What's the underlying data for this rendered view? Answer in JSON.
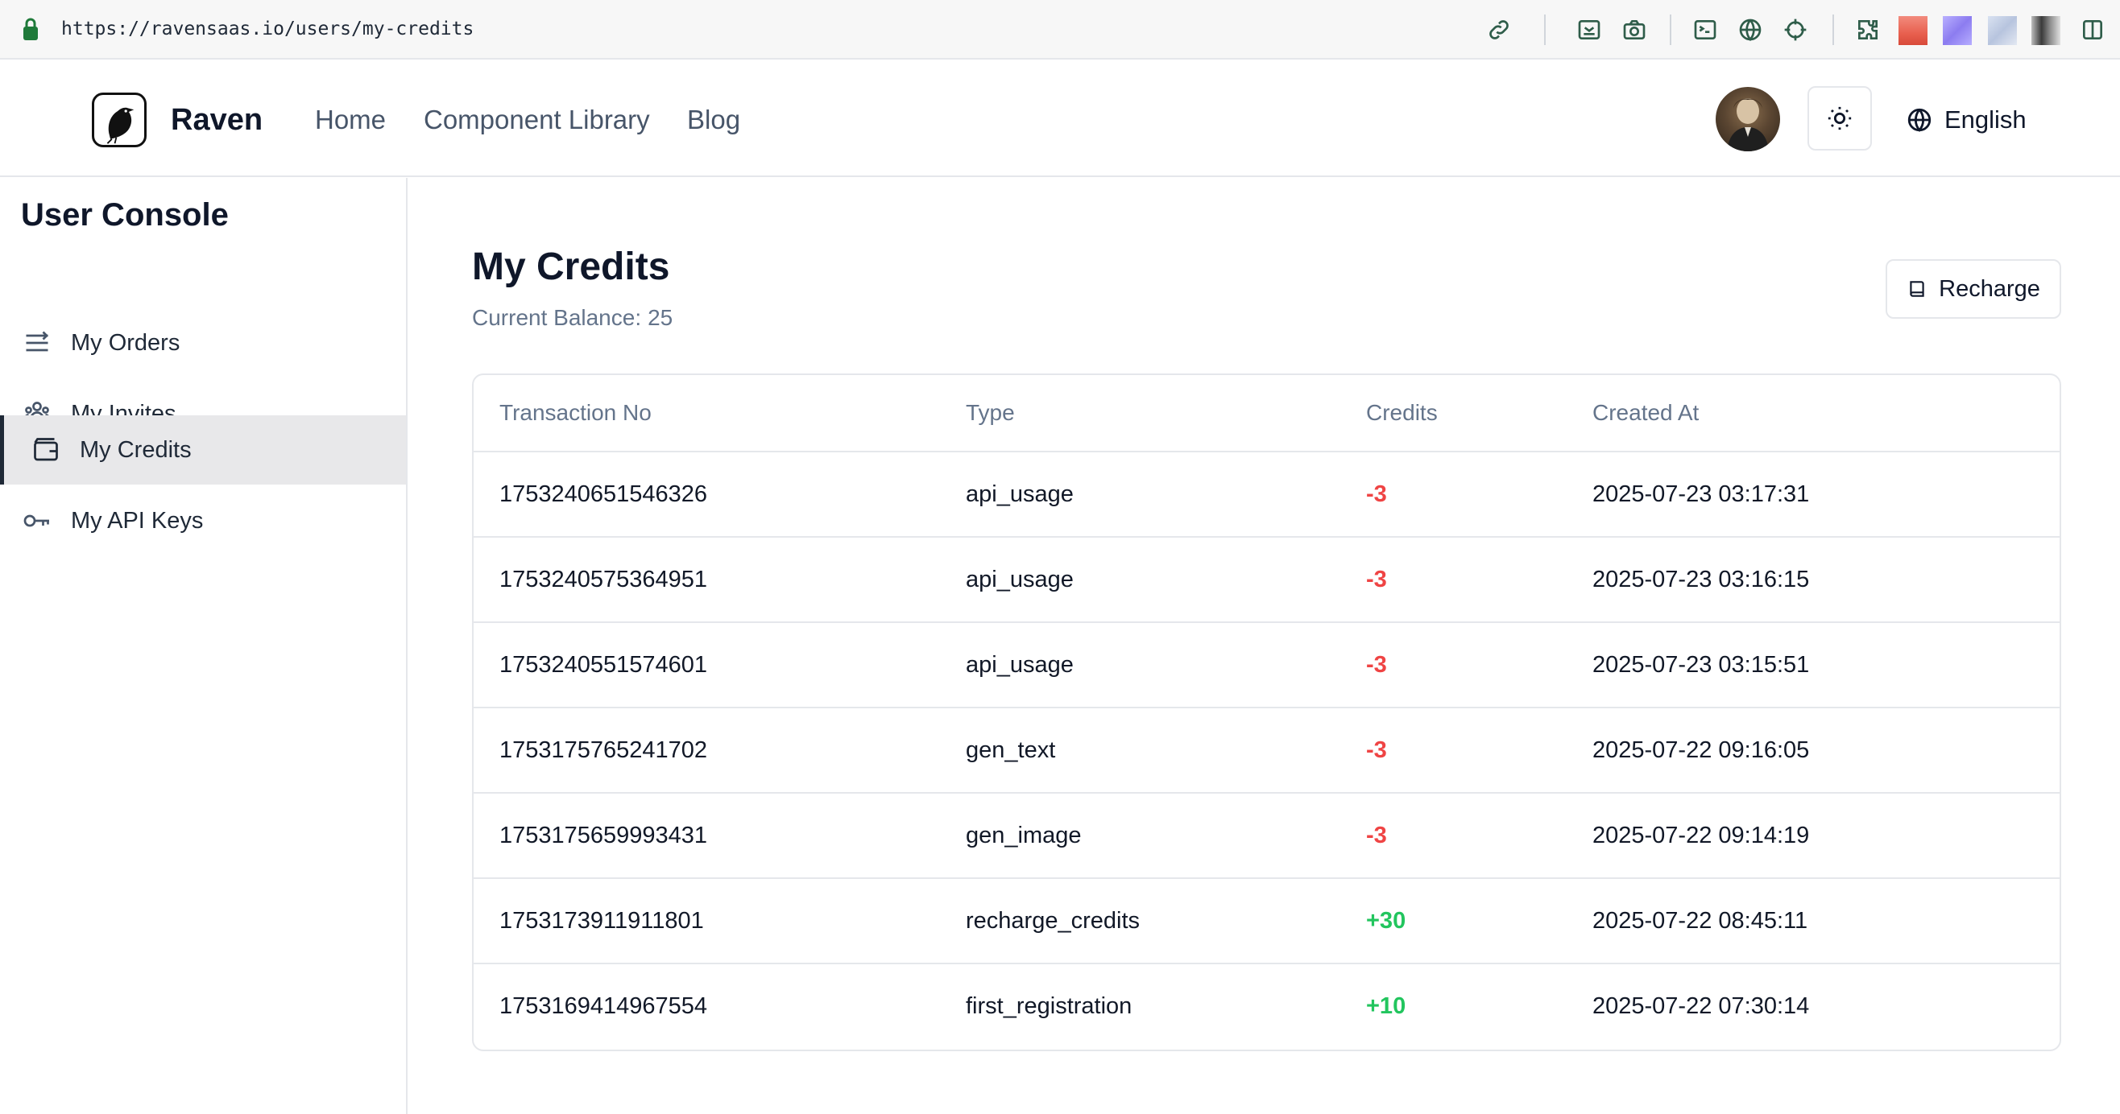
{
  "browser": {
    "url": "https://ravensaas.io/users/my-credits",
    "extension_icons": [
      "link-icon",
      "image-grab-icon",
      "camera-icon",
      "terminal-icon",
      "globe-icon",
      "crosshair-icon",
      "puzzle-icon",
      "sidebar-toggle-icon"
    ],
    "swatch_colors": [
      "#e8604f",
      "#8c7cf0",
      "#b7c4de",
      "#5c5c5c"
    ]
  },
  "header": {
    "brand": "Raven",
    "nav": [
      {
        "label": "Home"
      },
      {
        "label": "Component Library"
      },
      {
        "label": "Blog"
      }
    ],
    "language": "English"
  },
  "sidebar": {
    "title": "User Console",
    "items": [
      {
        "label": "My Orders",
        "icon": "list-icon",
        "active": false
      },
      {
        "label": "My Invites",
        "icon": "users-icon",
        "active": false
      },
      {
        "label": "My Credits",
        "icon": "wallet-icon",
        "active": true
      },
      {
        "label": "My API Keys",
        "icon": "key-icon",
        "active": false
      }
    ]
  },
  "main": {
    "title": "My Credits",
    "balance_label": "Current Balance:",
    "balance_value": "25",
    "recharge_label": "Recharge",
    "table": {
      "columns": [
        "Transaction No",
        "Type",
        "Credits",
        "Created At"
      ],
      "rows": [
        {
          "no": "1753240651546326",
          "type": "api_usage",
          "credits": "-3",
          "created_at": "2025-07-23 03:17:31"
        },
        {
          "no": "1753240575364951",
          "type": "api_usage",
          "credits": "-3",
          "created_at": "2025-07-23 03:16:15"
        },
        {
          "no": "1753240551574601",
          "type": "api_usage",
          "credits": "-3",
          "created_at": "2025-07-23 03:15:51"
        },
        {
          "no": "1753175765241702",
          "type": "gen_text",
          "credits": "-3",
          "created_at": "2025-07-22 09:16:05"
        },
        {
          "no": "1753175659993431",
          "type": "gen_image",
          "credits": "-3",
          "created_at": "2025-07-22 09:14:19"
        },
        {
          "no": "1753173911911801",
          "type": "recharge_credits",
          "credits": "+30",
          "created_at": "2025-07-22 08:45:11"
        },
        {
          "no": "1753169414967554",
          "type": "first_registration",
          "credits": "+10",
          "created_at": "2025-07-22 07:30:14"
        }
      ]
    }
  },
  "colors": {
    "negative": "#ef4444",
    "positive": "#22c55e",
    "active_bg": "#e8e8ea"
  }
}
